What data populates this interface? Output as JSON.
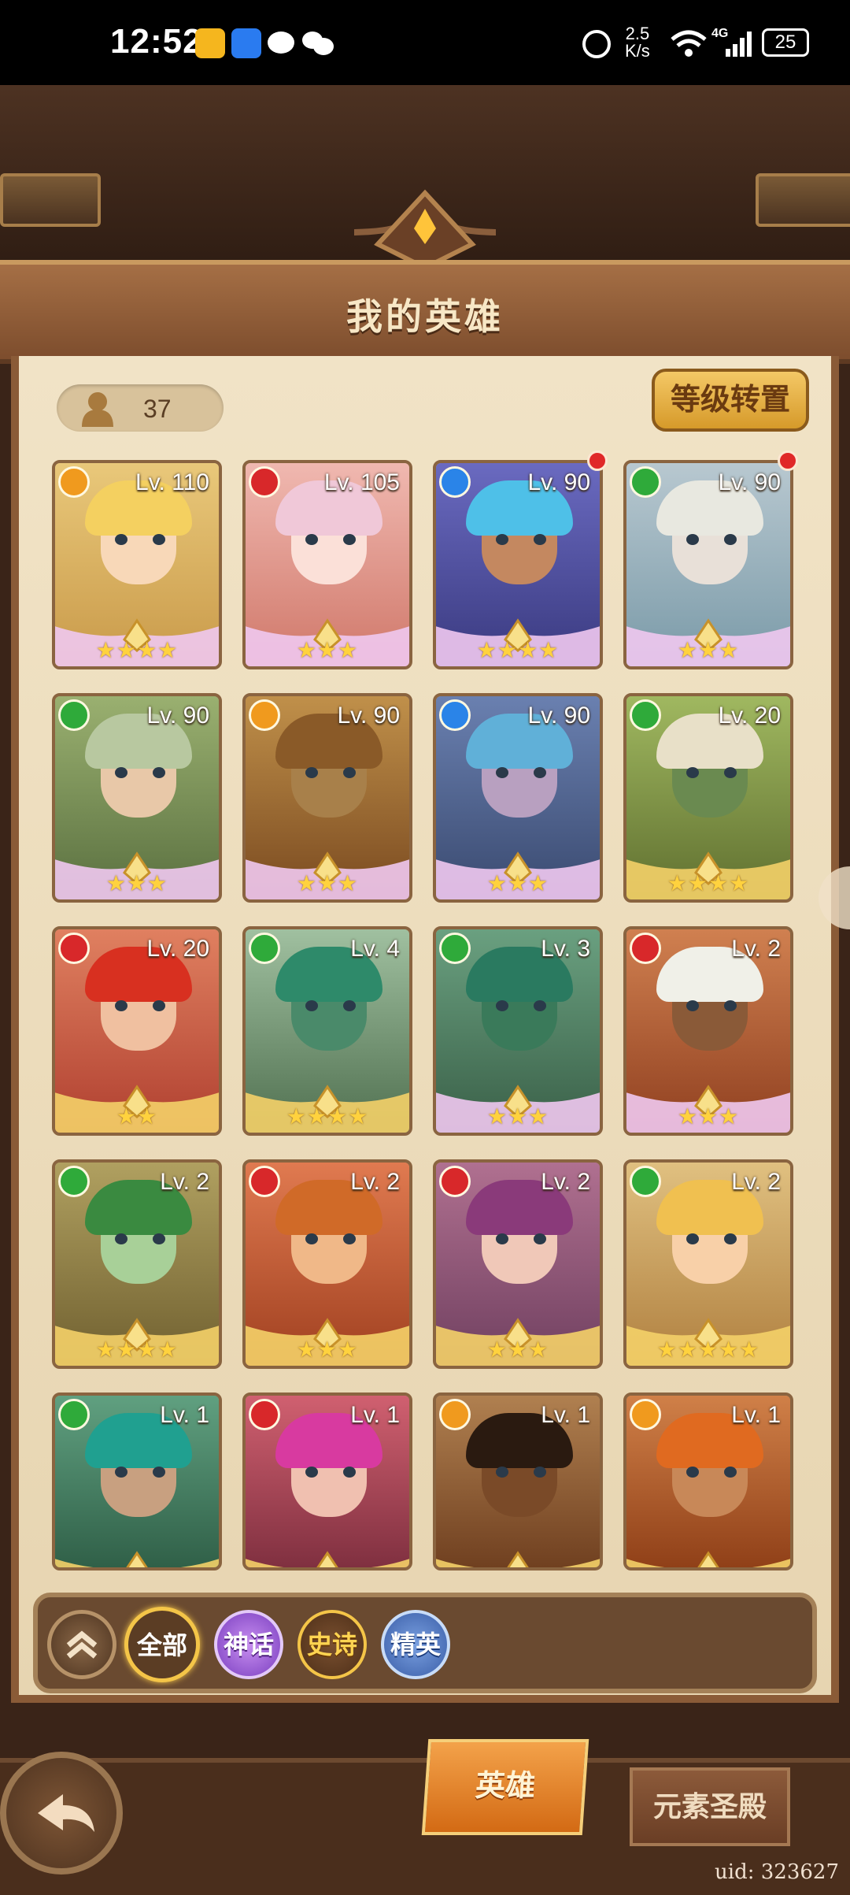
{
  "status_bar": {
    "time": "12:52",
    "net_speed_value": "2.5",
    "net_speed_unit": "K/s",
    "network_type": "4G",
    "battery": "25"
  },
  "page": {
    "title": "我的英雄",
    "hero_count": "37",
    "level_reset_label": "等级转置"
  },
  "heroes": [
    {
      "level": "Lv. 110",
      "element": "orange",
      "stars": "★★★★",
      "red_dot": false
    },
    {
      "level": "Lv. 105",
      "element": "red",
      "stars": "★★★",
      "red_dot": false
    },
    {
      "level": "Lv. 90",
      "element": "blue",
      "stars": "★★★★",
      "red_dot": true
    },
    {
      "level": "Lv. 90",
      "element": "green",
      "stars": "★★★",
      "red_dot": true
    },
    {
      "level": "Lv. 90",
      "element": "green",
      "stars": "★★★",
      "red_dot": false
    },
    {
      "level": "Lv. 90",
      "element": "orange",
      "stars": "★★★",
      "red_dot": false
    },
    {
      "level": "Lv. 90",
      "element": "blue",
      "stars": "★★★",
      "red_dot": false
    },
    {
      "level": "Lv. 20",
      "element": "green",
      "stars": "★★★★",
      "red_dot": false
    },
    {
      "level": "Lv. 20",
      "element": "red",
      "stars": "★★",
      "red_dot": false
    },
    {
      "level": "Lv. 4",
      "element": "green",
      "stars": "★★★★",
      "red_dot": false
    },
    {
      "level": "Lv. 3",
      "element": "green",
      "stars": "★★★",
      "red_dot": false
    },
    {
      "level": "Lv. 2",
      "element": "red",
      "stars": "★★★",
      "red_dot": false
    },
    {
      "level": "Lv. 2",
      "element": "green",
      "stars": "★★★★",
      "red_dot": false
    },
    {
      "level": "Lv. 2",
      "element": "red",
      "stars": "★★★",
      "red_dot": false
    },
    {
      "level": "Lv. 2",
      "element": "red",
      "stars": "★★★",
      "red_dot": false
    },
    {
      "level": "Lv. 2",
      "element": "green",
      "stars": "★★★★★",
      "red_dot": false
    },
    {
      "level": "Lv. 1",
      "element": "green",
      "stars": "",
      "red_dot": false
    },
    {
      "level": "Lv. 1",
      "element": "red",
      "stars": "",
      "red_dot": false
    },
    {
      "level": "Lv. 1",
      "element": "orange",
      "stars": "",
      "red_dot": false
    },
    {
      "level": "Lv. 1",
      "element": "orange",
      "stars": "",
      "red_dot": false
    }
  ],
  "filters": {
    "all": "全部",
    "mythic": "神话",
    "epic": "史诗",
    "elite": "精英"
  },
  "bottom_nav": {
    "hero_tab": "英雄",
    "temple_tab": "元素圣殿"
  },
  "uid": "uid: 323627"
}
